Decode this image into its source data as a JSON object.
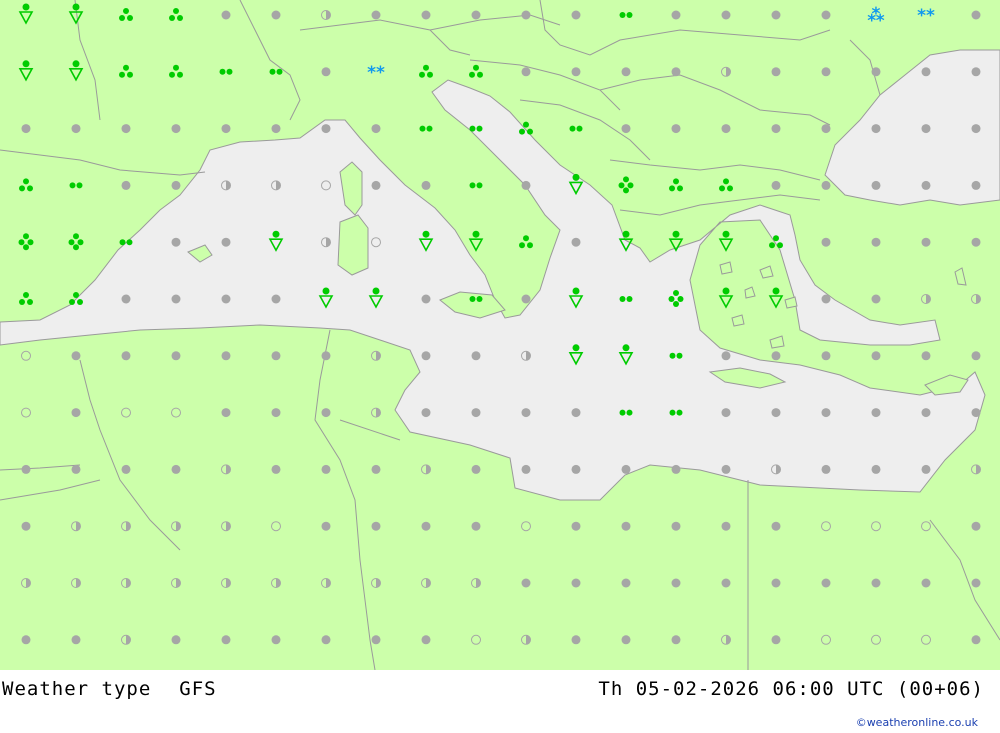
{
  "footer": {
    "title": "Weather type",
    "model": "GFS",
    "datetime": "Th 05-02-2026 06:00 UTC (00+06)",
    "credit": "©weatheronline.co.uk"
  },
  "colors": {
    "land": "#ccff aa",
    "sea": "#eeeeee",
    "border": "#9a9a9a",
    "dot": "#a6a6a6",
    "rain": "#00cc00",
    "snow": "#1199ee"
  },
  "legend_symbols": {
    "cloudy": "grey dot",
    "partly": "grey half-filled circle",
    "clear": "grey open circle",
    "rain_shower": "green dot over triangle",
    "rain_light": "two green dots",
    "rain_moderate": "three green dots",
    "rain_heavy": "four green dots",
    "snow": "blue asterisks"
  },
  "grid": {
    "columns": 20,
    "rows": 12,
    "cells": [
      [
        "S",
        "S",
        "R3",
        "R3",
        "C",
        "C",
        "P",
        "C",
        "C",
        "C",
        "C",
        "C",
        "R2",
        "C",
        "C",
        "C",
        "C",
        "Z3",
        "Z2",
        "C"
      ],
      [
        "S",
        "S",
        "R3",
        "R3",
        "R2",
        "R2",
        "C",
        "Z2",
        "R3",
        "R3",
        "C",
        "C",
        "C",
        "C",
        "P",
        "C",
        "C",
        "C",
        "C",
        "C"
      ],
      [
        "C",
        "C",
        "C",
        "C",
        "C",
        "C",
        "C",
        "C",
        "R2",
        "R2",
        "R3",
        "R2",
        "C",
        "C",
        "C",
        "C",
        "C",
        "C",
        "C",
        "C"
      ],
      [
        "R3",
        "R2",
        "C",
        "C",
        "P",
        "P",
        "O",
        "C",
        "C",
        "R2",
        "C",
        "S",
        "R4",
        "R3",
        "R3",
        "C",
        "C",
        "C",
        "C",
        "C"
      ],
      [
        "R4",
        "R4",
        "R2",
        "C",
        "C",
        "S",
        "P",
        "O",
        "S",
        "S",
        "R3",
        "C",
        "S",
        "S",
        "S",
        "R3",
        "C",
        "C",
        "C",
        "C"
      ],
      [
        "R3",
        "R3",
        "C",
        "C",
        "C",
        "C",
        "S",
        "S",
        "C",
        "R2",
        "C",
        "S",
        "R2",
        "R4",
        "S",
        "S",
        "C",
        "C",
        "P",
        "P"
      ],
      [
        "O",
        "C",
        "C",
        "C",
        "C",
        "C",
        "C",
        "P",
        "C",
        "C",
        "P",
        "S",
        "S",
        "R2",
        "C",
        "C",
        "C",
        "C",
        "C",
        "C"
      ],
      [
        "O",
        "C",
        "O",
        "O",
        "C",
        "C",
        "C",
        "P",
        "C",
        "C",
        "C",
        "C",
        "R2",
        "R2",
        "C",
        "C",
        "C",
        "C",
        "C",
        "C"
      ],
      [
        "C",
        "C",
        "C",
        "C",
        "P",
        "C",
        "C",
        "C",
        "P",
        "C",
        "C",
        "C",
        "C",
        "C",
        "C",
        "P",
        "C",
        "C",
        "C",
        "P"
      ],
      [
        "C",
        "P",
        "P",
        "P",
        "P",
        "O",
        "C",
        "C",
        "C",
        "C",
        "O",
        "C",
        "C",
        "C",
        "C",
        "C",
        "O",
        "O",
        "O",
        "C"
      ],
      [
        "P",
        "P",
        "P",
        "P",
        "P",
        "P",
        "P",
        "P",
        "P",
        "P",
        "C",
        "C",
        "C",
        "C",
        "C",
        "C",
        "C",
        "C",
        "C",
        "C"
      ],
      [
        "C",
        "C",
        "P",
        "C",
        "C",
        "C",
        "C",
        "C",
        "C",
        "O",
        "P",
        "C",
        "C",
        "C",
        "P",
        "C",
        "O",
        "O",
        "O",
        "C"
      ]
    ]
  }
}
